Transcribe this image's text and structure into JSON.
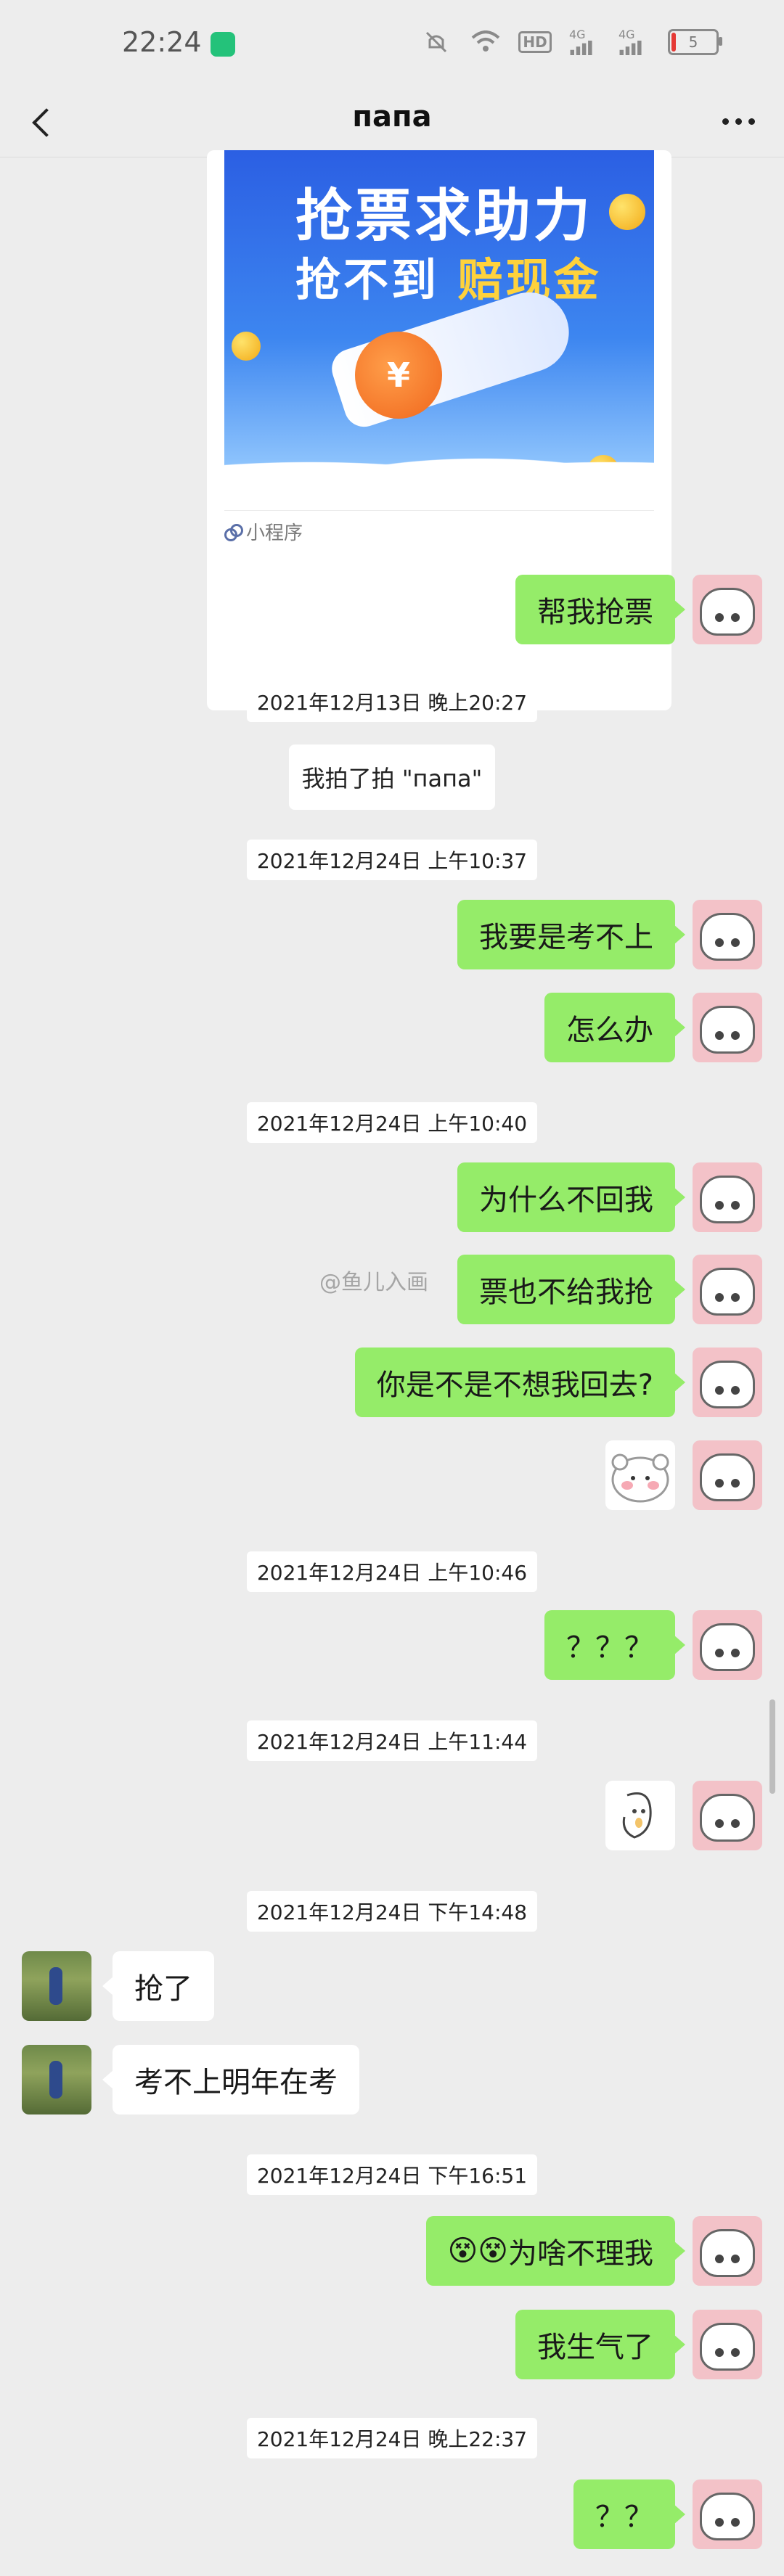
{
  "status_bar": {
    "time": "22:24",
    "hd_label": "HD",
    "signal1_label": "4G",
    "signal2_label": "4G",
    "battery_level": "5"
  },
  "header": {
    "title": "папа"
  },
  "mini_program": {
    "line1": "抢票求助力",
    "line2a": "抢不到 ",
    "line2b": "赔现金",
    "coin_symbol": "¥",
    "footer_label": "小程序"
  },
  "messages": [
    {
      "text": "帮我抢票"
    },
    {
      "timestamp": "2021年12月13日 晚上20:27"
    },
    {
      "system": "我拍了拍 \"папа\""
    },
    {
      "timestamp": "2021年12月24日 上午10:37"
    },
    {
      "text": "我要是考不上"
    },
    {
      "text": "怎么办"
    },
    {
      "timestamp": "2021年12月24日 上午10:40"
    },
    {
      "text": "为什么不回我"
    },
    {
      "text": "票也不给我抢"
    },
    {
      "text": "你是不是不想我回去?"
    },
    {
      "timestamp": "2021年12月24日 上午10:46"
    },
    {
      "text": "？？？"
    },
    {
      "timestamp": "2021年12月24日 上午11:44"
    },
    {
      "timestamp": "2021年12月24日 下午14:48"
    },
    {
      "text": "抢了"
    },
    {
      "text": "考不上明年在考"
    },
    {
      "timestamp": "2021年12月24日 下午16:51"
    },
    {
      "text": "为啥不理我"
    },
    {
      "text": "我生气了"
    },
    {
      "timestamp": "2021年12月24日 晚上22:37"
    },
    {
      "text": "？？"
    }
  ],
  "watermark": "@鱼儿入画",
  "emoji_prefix": "😵😵",
  "colors": {
    "sent_bubble": "#95ec69",
    "received_bubble": "#ffffff",
    "background": "#ededed"
  }
}
